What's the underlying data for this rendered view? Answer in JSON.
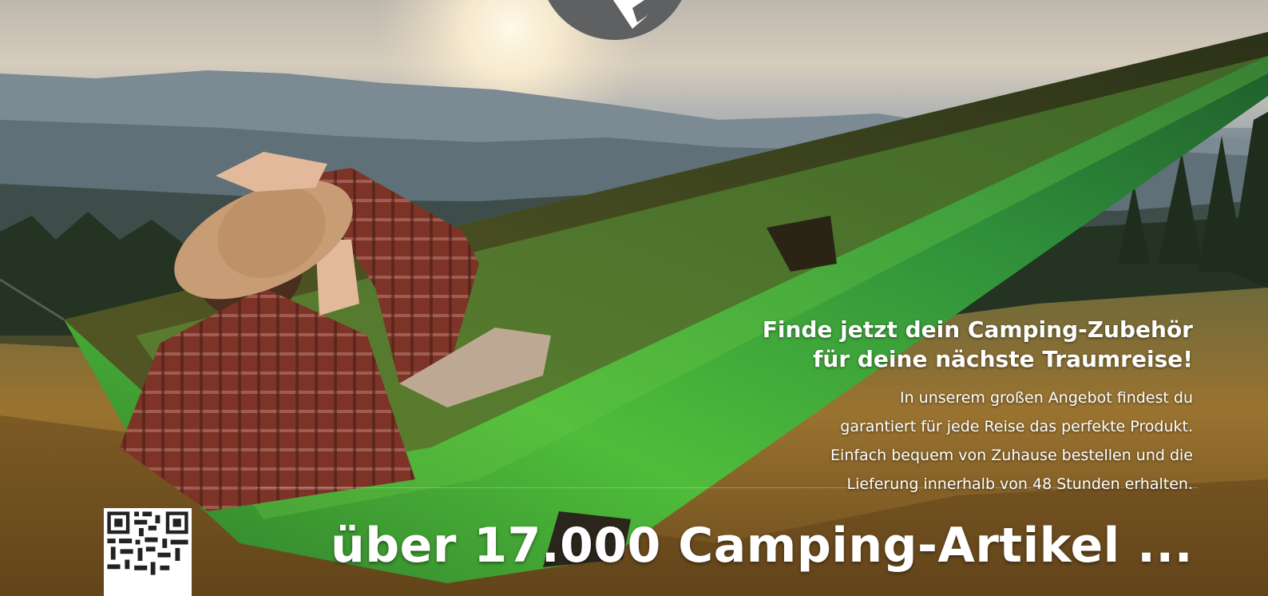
{
  "ad": {
    "headline_line1": "Finde jetzt dein Camping-Zubehör",
    "headline_line2": "für deine nächste Traumreise!",
    "body_line1": "In unserem großen Angebot findest du",
    "body_line2": "garantiert für jede Reise das perfekte Produkt.",
    "body_line3": "Einfach bequem von Zuhause bestellen und die",
    "body_line4": "Lieferung innerhalb von 48 Stunden erhalten.",
    "claim": "über 17.000 Camping-Artikel ..."
  },
  "colors": {
    "text": "#ffffff",
    "hammock_green": "#3fae3a",
    "hammock_dark": "#2f2a16",
    "shirt_red": "#8a3a2c",
    "hat": "#c69a72",
    "logo_gray": "#5f6062"
  },
  "icons": {
    "qr": "qr-code-icon",
    "logo": "logo-badge-icon"
  }
}
